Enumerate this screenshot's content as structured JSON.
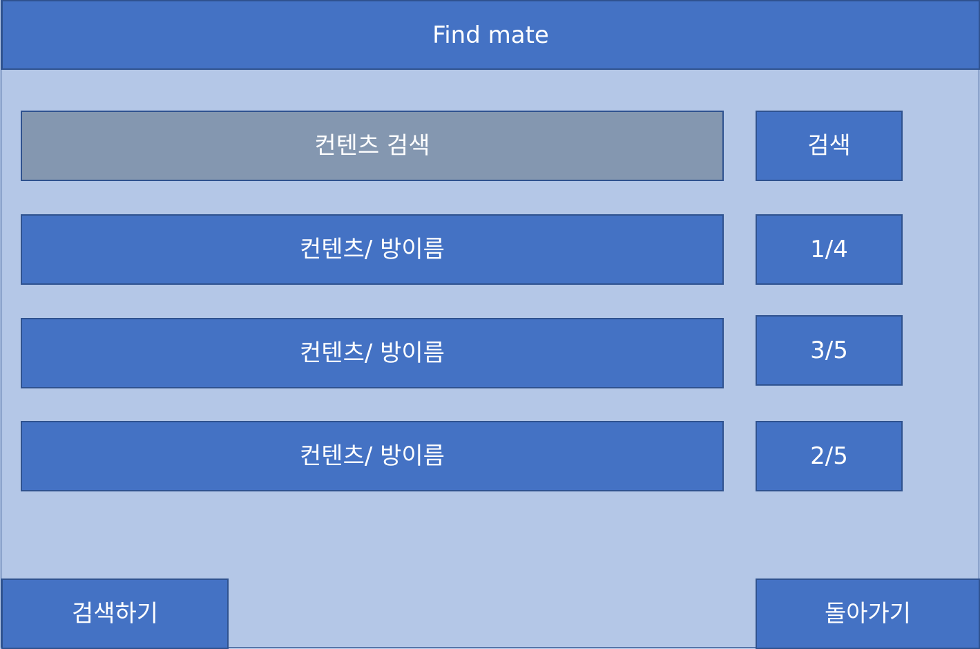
{
  "header": {
    "title": "Find mate"
  },
  "search": {
    "field_text": "컨텐츠 검색",
    "button_label": "검색"
  },
  "rooms": [
    {
      "label": "컨텐츠/ 방이름",
      "count": "1/4"
    },
    {
      "label": "컨텐츠/ 방이름",
      "count": "3/5"
    },
    {
      "label": "컨텐츠/ 방이름",
      "count": "2/5"
    }
  ],
  "footer": {
    "search_label": "검색하기",
    "back_label": "돌아가기"
  }
}
